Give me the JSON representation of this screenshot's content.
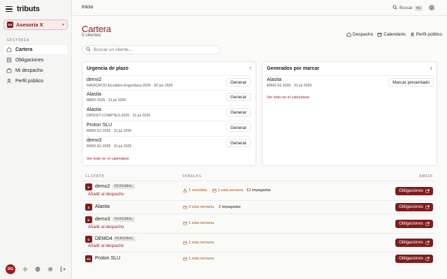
{
  "app": {
    "name": "tributs"
  },
  "org": {
    "badge": "AX",
    "name": "Asesoría X"
  },
  "sidebar": {
    "section": "GESTORÍA",
    "items": [
      {
        "label": "Cartera",
        "icon": "home-icon",
        "active": true
      },
      {
        "label": "Obligaciones",
        "icon": "list-icon",
        "active": false
      },
      {
        "label": "Mi despacho",
        "icon": "briefcase-icon",
        "active": false
      },
      {
        "label": "Perfil público",
        "icon": "user-icon",
        "active": false
      }
    ],
    "user_initials": "DG"
  },
  "header": {
    "breadcrumb": "Inicio",
    "search_placeholder": "Buscar",
    "search_shortcut": "⌘K"
  },
  "page": {
    "title": "Cartera",
    "subtitle": "5 clientes",
    "links": {
      "despacho": "Despacho",
      "calendario": "Calendario",
      "perfil": "Perfil público"
    },
    "client_search_placeholder": "Buscar un cliente..."
  },
  "deadlines": {
    "title": "Urgencia de plazo",
    "count": "?",
    "generate_label": "Generar",
    "calendar_link": "Ver todo en el calendario",
    "rows": [
      {
        "name": "demo2",
        "meta": "RADICACIO-Escaldes-Engordany-2026 · 30 jun 2026"
      },
      {
        "name": "Alastia",
        "meta": "M800-2025 · 31 jul 2026"
      },
      {
        "name": "Alastia",
        "meta": "DIPOSIT-COMPTES-2025 · 31 jul 2026"
      },
      {
        "name": "Proton SLU",
        "meta": "M900-S1-2026 · 31 jul 2026"
      },
      {
        "name": "demo3",
        "meta": "M900-S1-2026 · 31 jul 2026"
      }
    ]
  },
  "pending": {
    "title": "Generados por marcar",
    "count": "1",
    "mark_label": "Marcar presentado",
    "calendar_link": "Ver todo en el calendario",
    "rows": [
      {
        "name": "Alastia",
        "meta": "M900-S1-2026 · 31 jul 2026"
      }
    ]
  },
  "table": {
    "columns": {
      "client": "CLIENTE",
      "signals": "SEÑALES",
      "open": "ABRIR"
    },
    "obligations_label": "Obligaciones",
    "add_label": "Añadir al despacho",
    "rows": [
      {
        "badge": "D",
        "name": "demo2",
        "tag": "PERSONAL",
        "signals": [
          "1 vencidas",
          "1 esta semana",
          "12 impagadas"
        ]
      },
      {
        "badge": "A",
        "name": "Alastia",
        "tag": "",
        "signals": [
          "3 esta semana",
          "2 impagadas"
        ]
      },
      {
        "badge": "D",
        "name": "demo3",
        "tag": "PERSONAL",
        "signals": [
          "1 esta semana"
        ]
      },
      {
        "badge": "D",
        "name": "DEMO4",
        "tag": "PERSONAL",
        "signals": [
          "1 esta semana"
        ]
      },
      {
        "badge": "PS",
        "name": "Proton SLU",
        "tag": "",
        "signals": [
          "1 esta semana"
        ]
      }
    ]
  },
  "colors": {
    "accent": "#7f1d1d",
    "warning": "#b45309",
    "background": "#fafaf9"
  }
}
